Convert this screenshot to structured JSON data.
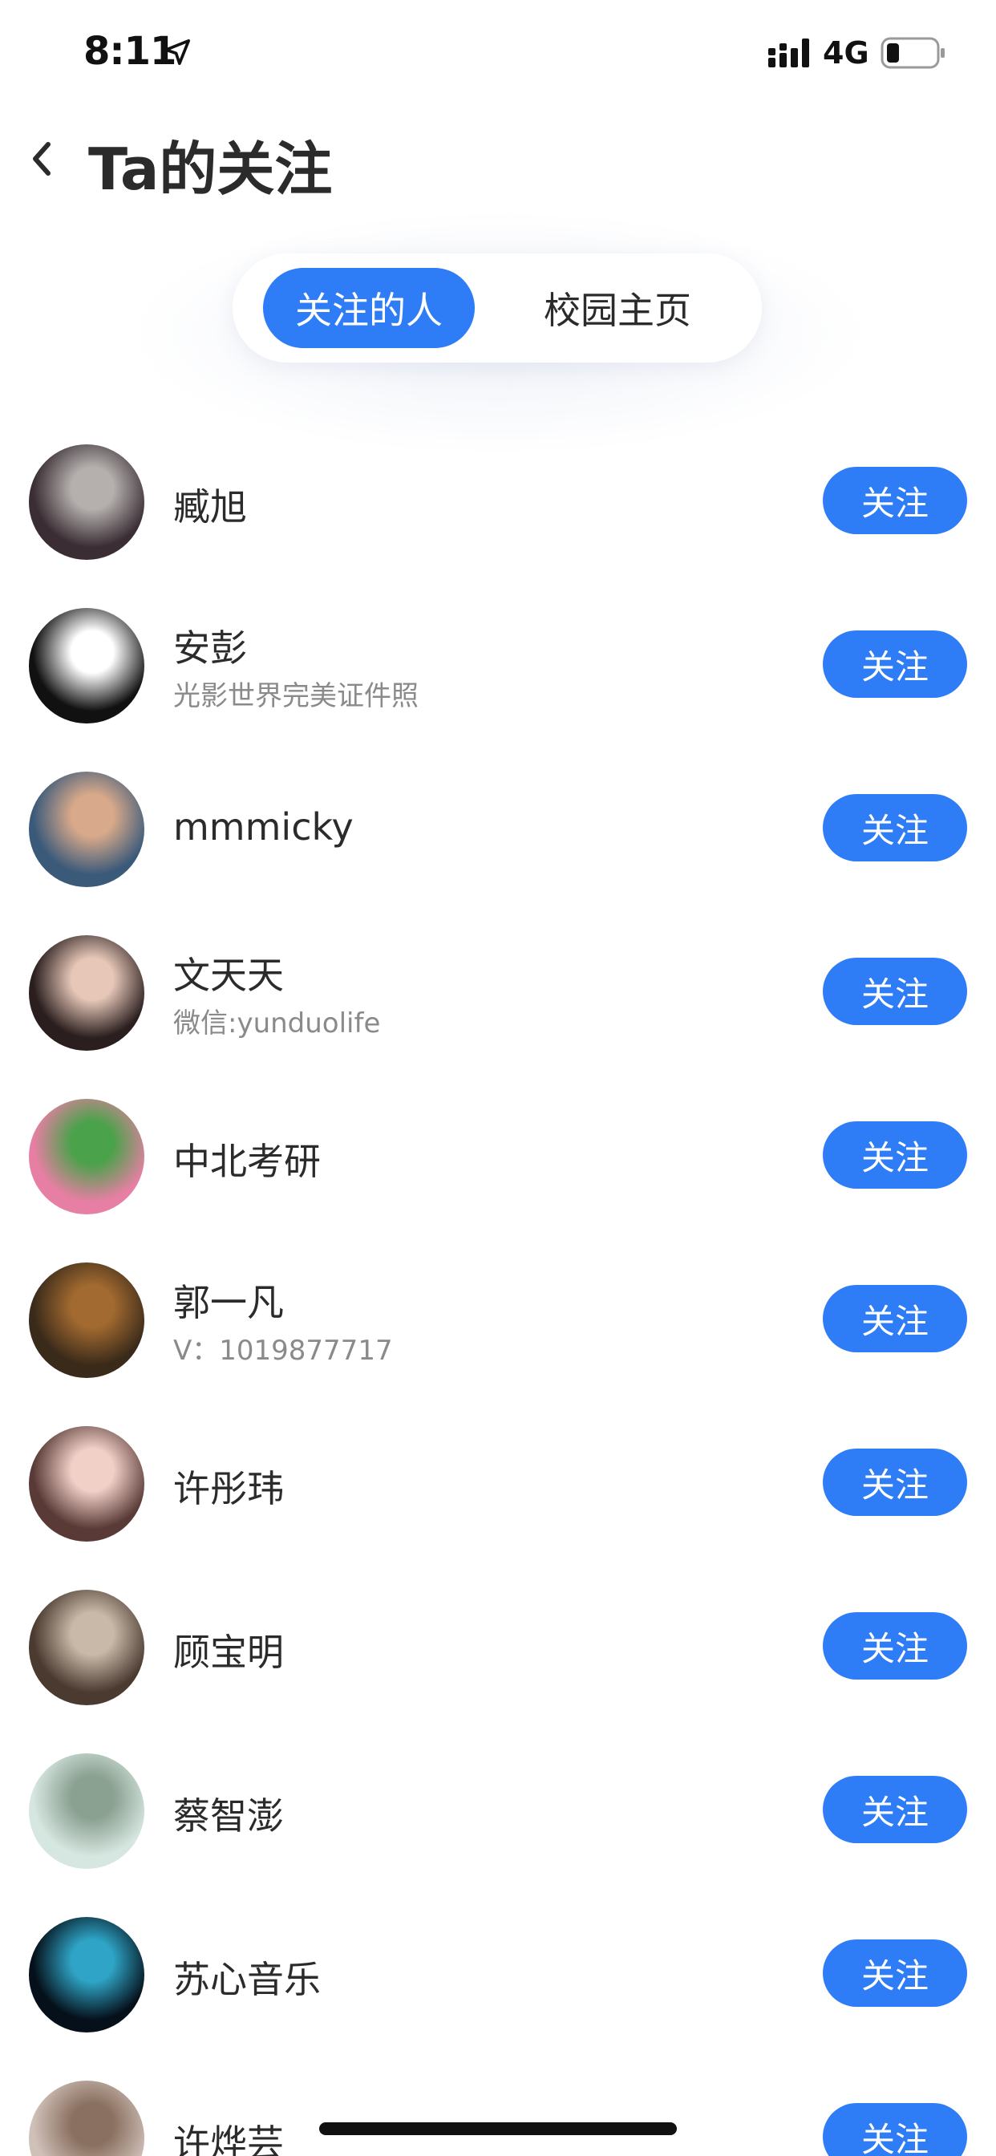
{
  "status_bar": {
    "time": "8:11",
    "network": "4G",
    "battery_level": 0.25
  },
  "header": {
    "title": "Ta的关注"
  },
  "tabs": [
    {
      "label": "关注的人",
      "active": true
    },
    {
      "label": "校园主页",
      "active": false
    }
  ],
  "follow_label": "关注",
  "users": [
    {
      "name": "臧旭",
      "bio": "",
      "avatar": [
        "#3a2e34",
        "#b5b0ae"
      ]
    },
    {
      "name": "安彭",
      "bio": "光影世界完美证件照",
      "avatar": [
        "#111111",
        "#ffffff"
      ]
    },
    {
      "name": "mmmicky",
      "bio": "",
      "avatar": [
        "#3b5a7a",
        "#d8a98a"
      ]
    },
    {
      "name": "文天天",
      "bio": "微信:yunduolife",
      "avatar": [
        "#2a1e1e",
        "#e6c7b8"
      ]
    },
    {
      "name": "中北考研",
      "bio": "",
      "avatar": [
        "#e77fa4",
        "#4aa24a"
      ]
    },
    {
      "name": "郭一凡",
      "bio": "V：1019877717",
      "avatar": [
        "#3a2a1a",
        "#a26a30"
      ]
    },
    {
      "name": "许彤玮",
      "bio": "",
      "avatar": [
        "#5a3a36",
        "#f1d0c8"
      ]
    },
    {
      "name": "顾宝明",
      "bio": "",
      "avatar": [
        "#4a3a30",
        "#c9b9a8"
      ]
    },
    {
      "name": "蔡智澎",
      "bio": "",
      "avatar": [
        "#d6e6e0",
        "#8aa090"
      ]
    },
    {
      "name": "苏心音乐",
      "bio": "",
      "avatar": [
        "#05101a",
        "#2fa4c6"
      ]
    },
    {
      "name": "许烨芸",
      "bio": "",
      "avatar": [
        "#cfc0b8",
        "#8a7060"
      ]
    }
  ],
  "colors": {
    "accent": "#2e7cf6",
    "text": "#2b2b2b",
    "secondary_text": "#8a8a8a"
  }
}
